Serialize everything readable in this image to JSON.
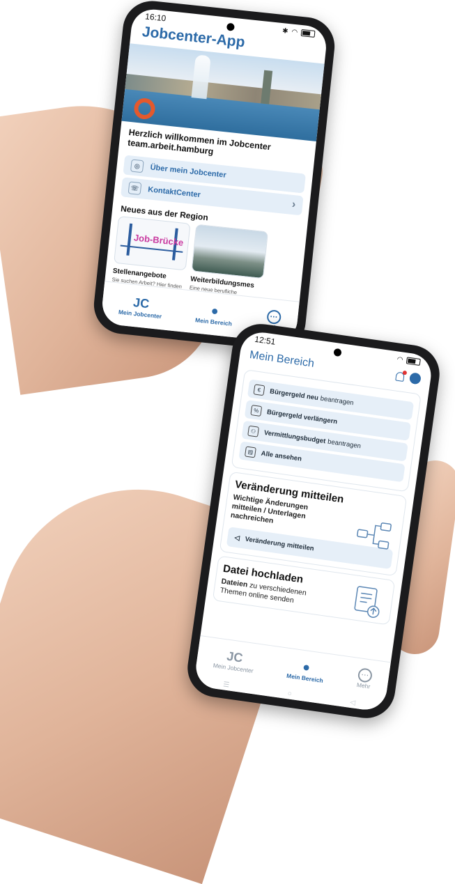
{
  "phone1": {
    "status": {
      "time": "16:10"
    },
    "app_title": "Jobcenter-App",
    "welcome": "Herzlich willkommen im Jobcenter team.arbeit.hamburg",
    "links": [
      {
        "icon": "brain-icon",
        "label": "Über mein Jobcenter"
      },
      {
        "icon": "phone-icon",
        "label": "KontaktCenter"
      }
    ],
    "news_title": "Neues aus der Region",
    "cards": [
      {
        "brand": "Job-Brücke",
        "title": "Stellenangebote",
        "text": "Sie suchen Arbeit? Hier finden Sie aktuelle Stellenangebote, z.B. als"
      },
      {
        "title": "Weiterbildungsmes",
        "text": "Eine neue berufliche Herausforderung ist ihr Z... Dann sind Sie auf der"
      }
    ],
    "tabs": [
      {
        "icon": "JC",
        "label": "Mein Jobcenter"
      },
      {
        "icon": "person-icon",
        "label": "Mein Bereich"
      },
      {
        "icon": "more-icon",
        "label": "Mehr"
      }
    ]
  },
  "phone2": {
    "status": {
      "time": "12:51"
    },
    "title": "Mein Bereich",
    "actions": [
      {
        "icon": "euro-icon",
        "bold": "Bürgergeld neu",
        "rest": "beantragen"
      },
      {
        "icon": "document-icon",
        "bold": "Bürgergeld verlängern",
        "rest": ""
      },
      {
        "icon": "people-icon",
        "bold": "Vermittlungsbudget",
        "rest": "beantragen"
      },
      {
        "icon": "file-icon",
        "bold": "Alle ansehen",
        "rest": ""
      }
    ],
    "change": {
      "title": "Veränderung mitteilen",
      "subtitle": "Wichtige Änderungen mitteilen / Unterlagen nachreichen",
      "button": "Veränderung mitteilen"
    },
    "upload": {
      "title": "Datei hochladen",
      "bold": "Dateien",
      "text": "zu verschiedenen Themen online senden"
    },
    "tabs": [
      {
        "icon": "JC",
        "label": "Mein Jobcenter"
      },
      {
        "icon": "person-icon",
        "label": "Mein Bereich"
      },
      {
        "icon": "more-icon",
        "label": "Mehr"
      }
    ]
  }
}
